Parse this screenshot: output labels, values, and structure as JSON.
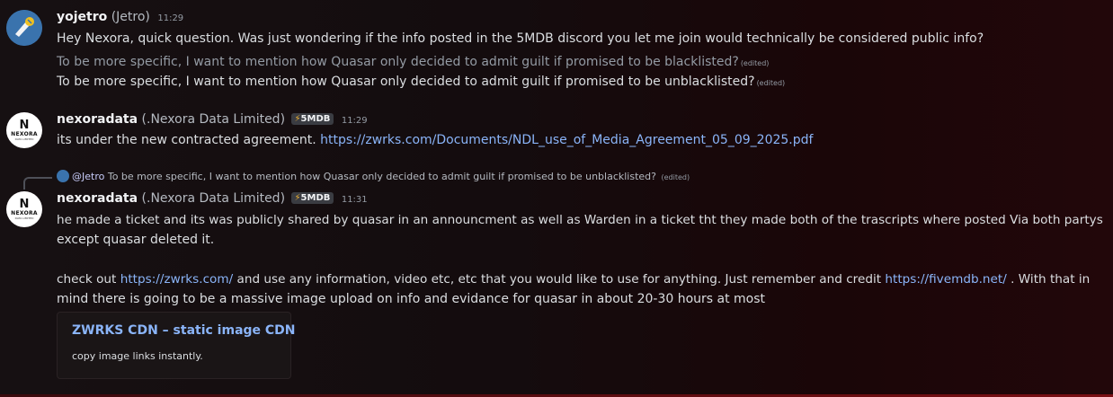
{
  "messages": [
    {
      "username": "yojetro",
      "nick": "(Jetro)",
      "time": "11:29",
      "lines": [
        "Hey Nexora, quick question. Was just wondering if the info posted in the 5MDB discord you let me join would technically be considered public info?",
        "To be more specific, I want to mention how Quasar only decided to admit guilt if promised to be blacklisted?",
        "To be more specific, I want to mention how Quasar only decided to admit guilt if promised to be unblacklisted?"
      ],
      "edited_label": "(edited)"
    },
    {
      "username": "nexoradata",
      "nick": "(.Nexora Data Limited)",
      "badge": "5MDB",
      "time": "11:29",
      "text_prefix": "its under the new contracted agreement.",
      "link": "https://zwrks.com/Documents/NDL_use_of_Media_Agreement_05_09_2025.pdf"
    },
    {
      "reply": {
        "mention": "@Jetro",
        "text": "To be more specific, I want to mention how Quasar only decided to admit guilt if promised to be unblacklisted?",
        "edited_label": "(edited)"
      },
      "username": "nexoradata",
      "nick": "(.Nexora Data Limited)",
      "badge": "5MDB",
      "time": "11:31",
      "para1_line1": "he made a ticket and its was publicly shared by quasar in an announcment as well as Warden in a ticket tht they made both of the trascripts where posted Via both partys",
      "para1_line2": "except quasar deleted it.",
      "para2_part1": "check out",
      "para2_link1": "https://zwrks.com/",
      "para2_part2": "and use any information, video etc, etc that you would like to use for anything. Just remember and credit",
      "para2_link2": "https://fivemdb.net/",
      "para2_part3": ". With that in",
      "para2_line2": "mind there is going to be a massive image upload on info and evidance for quasar in about 20-30 hours at most",
      "embed": {
        "title": "ZWRKS CDN –  static image CDN",
        "description": "copy image links instantly."
      }
    }
  ],
  "avatar_text": {
    "mark": "N",
    "word": "NEXORA",
    "sub": "DATA LIMITED"
  },
  "colors": {
    "link": "#8ab4f8",
    "badge_bolt": "#f0b232",
    "jetro_avatar": "#3a73ad"
  }
}
